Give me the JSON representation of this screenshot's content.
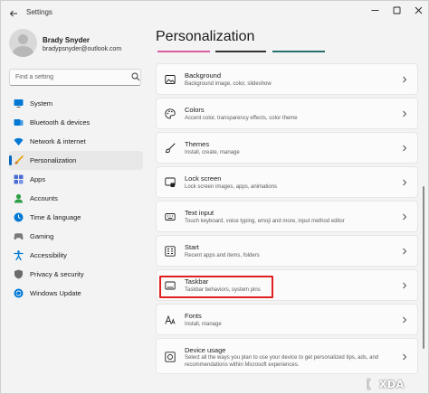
{
  "window": {
    "title": "Settings",
    "back_icon": "back-arrow-icon",
    "minimize_icon": "minimize-icon",
    "maximize_icon": "maximize-icon",
    "close_icon": "close-icon"
  },
  "user": {
    "name": "Brady Snyder",
    "email": "bradypsnyder@outlook.com"
  },
  "search": {
    "placeholder": "Find a setting",
    "icon": "search-icon"
  },
  "sidebar": {
    "items": [
      {
        "label": "System",
        "icon": "system-monitor-icon",
        "color": "#0078d4",
        "active": false
      },
      {
        "label": "Bluetooth & devices",
        "icon": "bluetooth-icon",
        "color": "#0078d4",
        "active": false
      },
      {
        "label": "Network & internet",
        "icon": "wifi-icon",
        "color": "#0078d4",
        "active": false
      },
      {
        "label": "Personalization",
        "icon": "paintbrush-icon",
        "color": "#e8a300",
        "active": true
      },
      {
        "label": "Apps",
        "icon": "apps-icon",
        "color": "#4a6cd4",
        "active": false
      },
      {
        "label": "Accounts",
        "icon": "accounts-icon",
        "color": "#2c9f45",
        "active": false
      },
      {
        "label": "Time & language",
        "icon": "time-language-icon",
        "color": "#0078d4",
        "active": false
      },
      {
        "label": "Gaming",
        "icon": "gaming-controller-icon",
        "color": "#7a7a7a",
        "active": false
      },
      {
        "label": "Accessibility",
        "icon": "accessibility-icon",
        "color": "#0078d4",
        "active": false
      },
      {
        "label": "Privacy & security",
        "icon": "shield-icon",
        "color": "#6b6b6b",
        "active": false
      },
      {
        "label": "Windows Update",
        "icon": "windows-update-icon",
        "color": "#0078d4",
        "active": false
      }
    ]
  },
  "main": {
    "title": "Personalization",
    "cards": [
      {
        "title": "Background",
        "desc": "Background image, color, slideshow",
        "icon": "image-icon"
      },
      {
        "title": "Colors",
        "desc": "Accent color, transparency effects, color theme",
        "icon": "palette-icon"
      },
      {
        "title": "Themes",
        "desc": "Install, create, manage",
        "icon": "brush-icon"
      },
      {
        "title": "Lock screen",
        "desc": "Lock screen images, apps, animations",
        "icon": "lock-screen-icon"
      },
      {
        "title": "Text input",
        "desc": "Touch keyboard, voice typing, emoji and more, input method editor",
        "icon": "keyboard-icon"
      },
      {
        "title": "Start",
        "desc": "Recent apps and items, folders",
        "icon": "start-grid-icon"
      },
      {
        "title": "Taskbar",
        "desc": "Taskbar behaviors, system pins",
        "icon": "taskbar-icon"
      },
      {
        "title": "Fonts",
        "desc": "Install, manage",
        "icon": "fonts-icon"
      },
      {
        "title": "Device usage",
        "desc_line1": "Select all the ways you plan to use your device to get personalized tips, ads, and",
        "desc_line2": "recommendations within Microsoft experiences.",
        "icon": "device-usage-icon"
      }
    ]
  },
  "colors": {
    "accent": "#0067c0",
    "highlight_box": "#e02020"
  },
  "watermark": {
    "text": "XDA",
    "icon": "xda-logo-icon"
  }
}
